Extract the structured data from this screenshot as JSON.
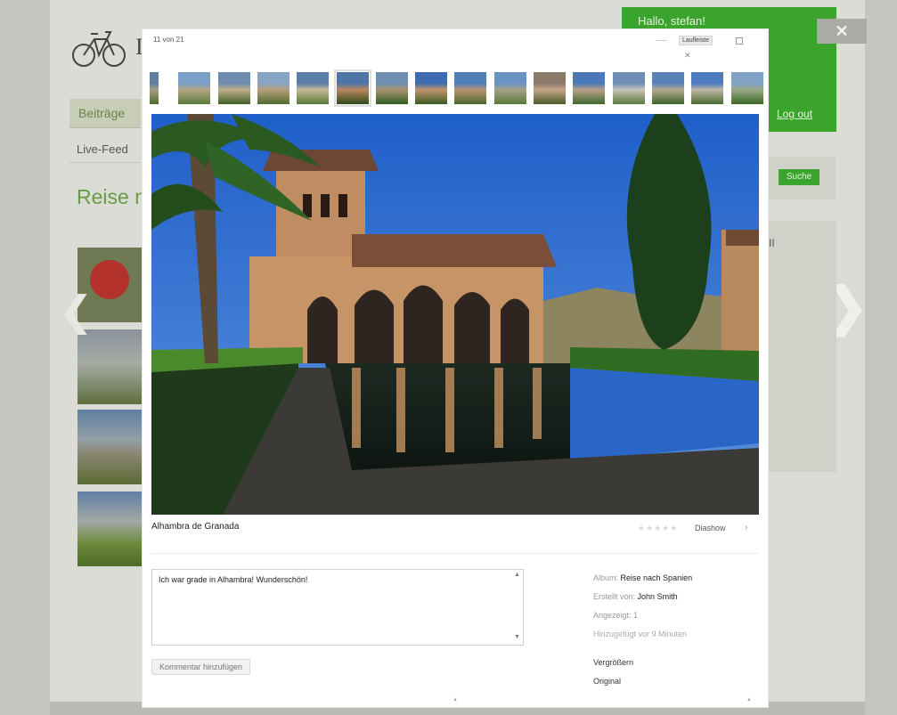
{
  "background_page": {
    "greeting": "Hallo, stefan!",
    "logout_link": "Log out",
    "nav_tab": "Beiträge",
    "live_feed": "Live-Feed",
    "headline": "Reise n",
    "logo_letter": "I",
    "search_button": "Suche",
    "side_box_text": "II",
    "close_label": "✕"
  },
  "lightbox": {
    "counter": "11 von 21",
    "control_label": "Laufleiste",
    "control_close": "✕",
    "caption": "Alhambra de Granada",
    "rating_stars": "★★★★★",
    "slideshow_label": "Diashow",
    "slideshow_arrow": "›",
    "comment_value": "Ich war grade in Alhambra! Wunderschön!",
    "add_comment_button": "Kommentar hinzufügen",
    "meta": {
      "album_label": "Album:",
      "album_value": "Reise nach Spanien",
      "created_label": "Erstellt von:",
      "created_value": "John Smith",
      "views_label": "Angezeigt:",
      "views_value": "1",
      "added_text": "Hinzugefügt vor 9 Minuten"
    },
    "links": {
      "enlarge": "Vergrößern",
      "original": "Original"
    },
    "filmstrip_count": 16,
    "filmstrip_active_index": 5
  },
  "colors": {
    "accent_green": "#3aa42d",
    "headline_green": "#6a9a44",
    "sky_blue": "#2d6dcf"
  },
  "icons": {
    "prev": "chevron-left-icon",
    "next": "chevron-right-icon",
    "close": "close-icon",
    "logo": "bicycle-icon"
  }
}
